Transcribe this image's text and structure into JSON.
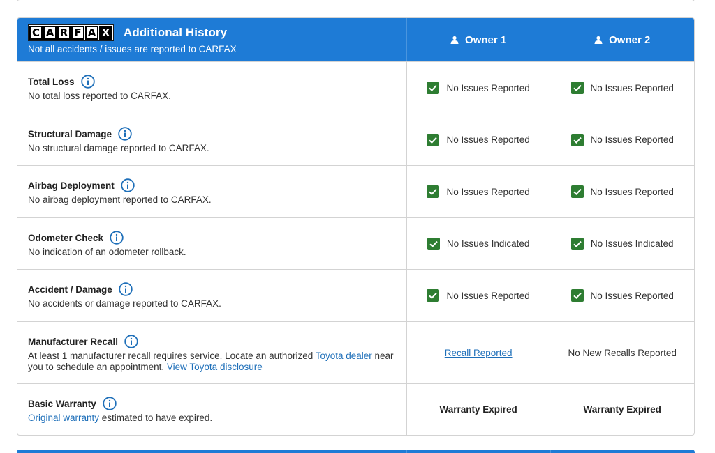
{
  "header": {
    "logo_letters": [
      "C",
      "A",
      "R",
      "F",
      "A",
      "X"
    ],
    "title": "Additional History",
    "subtitle": "Not all accidents / issues are reported to CARFAX",
    "owner1": "Owner 1",
    "owner2": "Owner 2"
  },
  "rows": [
    {
      "title": "Total Loss",
      "desc": "No total loss reported to CARFAX.",
      "owner1": "No Issues Reported",
      "owner2": "No Issues Reported"
    },
    {
      "title": "Structural Damage",
      "desc": "No structural damage reported to CARFAX.",
      "owner1": "No Issues Reported",
      "owner2": "No Issues Reported"
    },
    {
      "title": "Airbag Deployment",
      "desc": "No airbag deployment reported to CARFAX.",
      "owner1": "No Issues Reported",
      "owner2": "No Issues Reported"
    },
    {
      "title": "Odometer Check",
      "desc": "No indication of an odometer rollback.",
      "owner1": "No Issues Indicated",
      "owner2": "No Issues Indicated"
    },
    {
      "title": "Accident / Damage",
      "desc": "No accidents or damage reported to CARFAX.",
      "owner1": "No Issues Reported",
      "owner2": "No Issues Reported"
    }
  ],
  "recall": {
    "title": "Manufacturer Recall",
    "desc_before": "At least 1 manufacturer recall requires service. Locate an authorized ",
    "dealer_link": "Toyota dealer",
    "desc_after": " near you to schedule an appointment. ",
    "disclosure_link": "View Toyota disclosure",
    "owner1_link": "Recall Reported",
    "owner2": "No New Recalls Reported"
  },
  "warranty": {
    "title": "Basic Warranty",
    "desc_link": "Original warranty",
    "desc_after": " estimated to have expired.",
    "owner1": "Warranty Expired",
    "owner2": "Warranty Expired"
  },
  "icons": {
    "info": "info-circle-icon",
    "check": "checkbox-checked-icon",
    "person": "person-icon"
  },
  "colors": {
    "header_blue": "#1e7bd6",
    "check_green": "#2e7d32",
    "info_blue": "#1e6fb9",
    "link_blue": "#1e6fb9"
  }
}
